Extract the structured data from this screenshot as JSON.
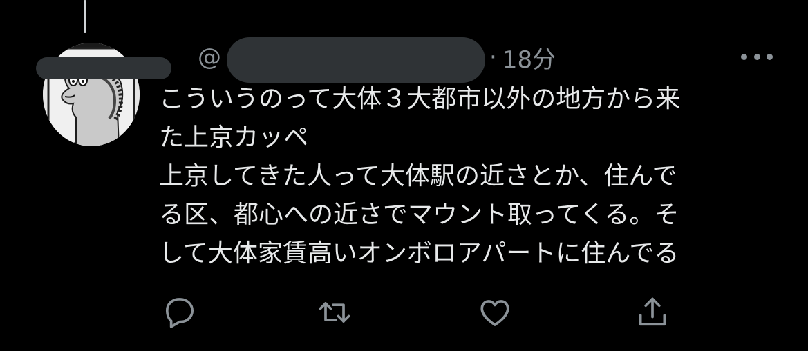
{
  "tweet": {
    "handle_prefix": "@",
    "separator": "·",
    "timestamp": "18分",
    "text_lines": [
      "こういうのって大体３大都市以外の地方から来",
      "た上京カッペ",
      "上京してきた人って大体駅の近さとか、住んで",
      "る区、都心への近さでマウント取ってくる。そ",
      "して大体家賃高いオンボロアパートに住んでる"
    ]
  },
  "icons": {
    "more": "more-dots-icon",
    "reply": "reply-icon",
    "retweet": "retweet-icon",
    "like": "like-icon",
    "share": "share-icon"
  },
  "colors": {
    "background": "#000000",
    "text": "#e7e9ea",
    "secondary": "#8b9298",
    "redaction": "#2f3336"
  }
}
